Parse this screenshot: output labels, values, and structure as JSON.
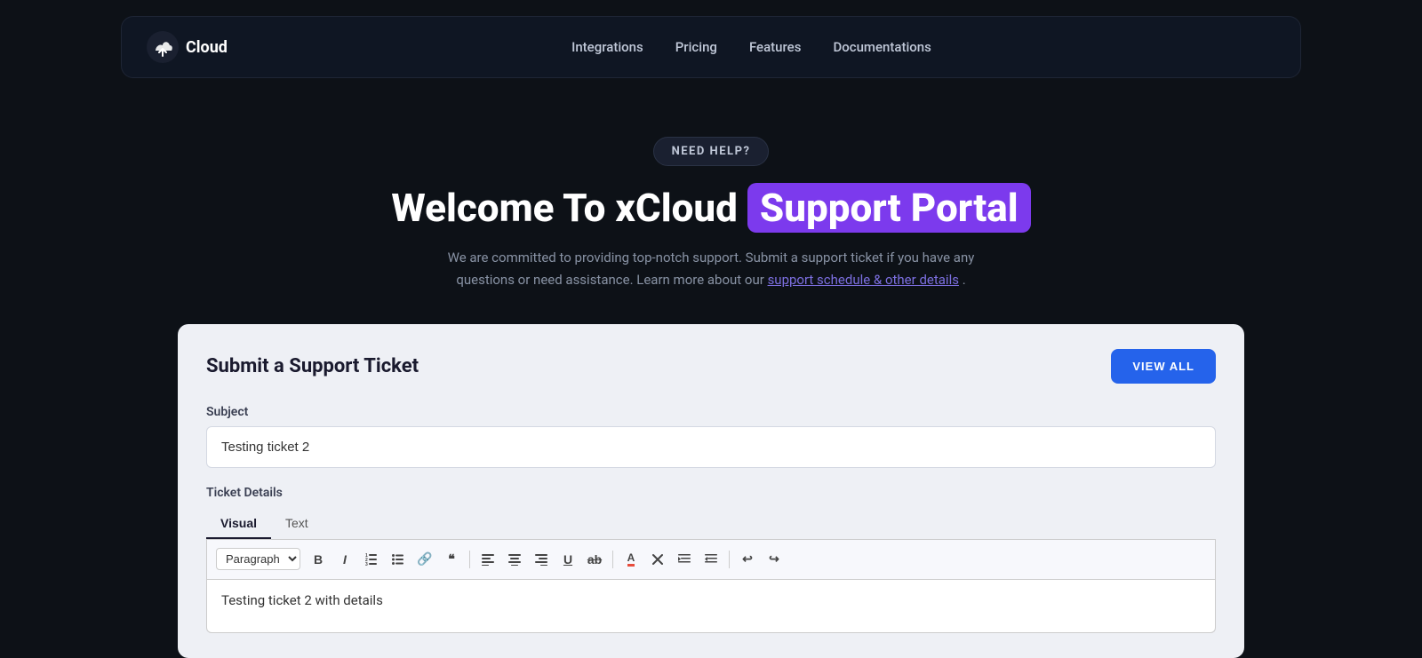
{
  "navbar": {
    "logo_text": "Cloud",
    "links": [
      {
        "label": "Integrations"
      },
      {
        "label": "Pricing"
      },
      {
        "label": "Features"
      },
      {
        "label": "Documentations"
      }
    ]
  },
  "hero": {
    "badge": "NEED HELP?",
    "title_prefix": "Welcome To xCloud",
    "title_highlight": "Support Portal",
    "subtitle": "We are committed to providing top-notch support. Submit a support ticket if you have any questions or need assistance. Learn more about our",
    "subtitle_link": "support schedule & other details",
    "subtitle_suffix": "."
  },
  "form": {
    "title": "Submit a Support Ticket",
    "view_all_label": "VIEW ALL",
    "subject_label": "Subject",
    "subject_placeholder": "Testing ticket 2",
    "details_label": "Ticket Details",
    "tab_visual": "Visual",
    "tab_text": "Text",
    "toolbar_select": "Paragraph",
    "editor_content": "Testing ticket 2 with details"
  }
}
